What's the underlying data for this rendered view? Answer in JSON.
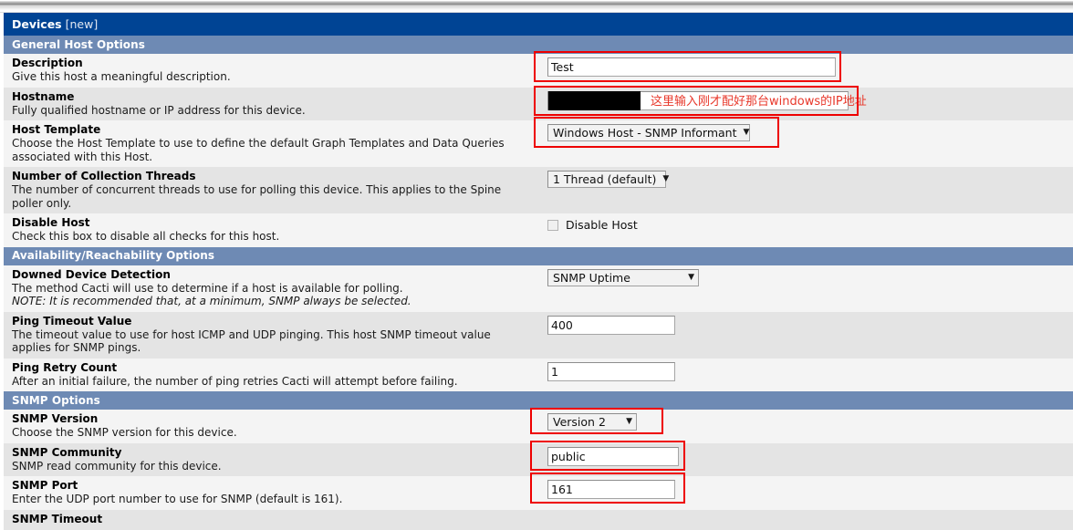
{
  "window": {
    "title_strong": "Devices",
    "title_suffix": "[new]"
  },
  "sections": {
    "general": "General Host Options",
    "availability": "Availability/Reachability Options",
    "snmp": "SNMP Options"
  },
  "fields": {
    "description": {
      "name": "Description",
      "desc": "Give this host a meaningful description.",
      "value": "Test"
    },
    "hostname": {
      "name": "Hostname",
      "desc": "Fully qualified hostname or IP address for this device.",
      "value": "",
      "annotation": "这里输入刚才配好那台windows的IP地址"
    },
    "host_template": {
      "name": "Host Template",
      "desc": "Choose the Host Template to use to define the default Graph Templates and Data Queries associated with this Host.",
      "value": "Windows Host - SNMP Informant"
    },
    "collection_threads": {
      "name": "Number of Collection Threads",
      "desc": "The number of concurrent threads to use for polling this device. This applies to the Spine poller only.",
      "value": "1 Thread (default)"
    },
    "disable_host": {
      "name": "Disable Host",
      "desc": "Check this box to disable all checks for this host.",
      "checkbox_label": "Disable Host",
      "checked": false
    },
    "downed_device_detection": {
      "name": "Downed Device Detection",
      "desc": "The method Cacti will use to determine if a host is available for polling.",
      "note": "NOTE: It is recommended that, at a minimum, SNMP always be selected.",
      "value": "SNMP Uptime"
    },
    "ping_timeout": {
      "name": "Ping Timeout Value",
      "desc": "The timeout value to use for host ICMP and UDP pinging. This host SNMP timeout value applies for SNMP pings.",
      "value": "400"
    },
    "ping_retry": {
      "name": "Ping Retry Count",
      "desc": "After an initial failure, the number of ping retries Cacti will attempt before failing.",
      "value": "1"
    },
    "snmp_version": {
      "name": "SNMP Version",
      "desc": "Choose the SNMP version for this device.",
      "value": "Version 2"
    },
    "snmp_community": {
      "name": "SNMP Community",
      "desc": "SNMP read community for this device.",
      "value": "public"
    },
    "snmp_port": {
      "name": "SNMP Port",
      "desc": "Enter the UDP port number to use for SNMP (default is 161).",
      "value": "161"
    },
    "snmp_timeout": {
      "name": "SNMP Timeout"
    }
  },
  "colors": {
    "title_bar": "#004494",
    "section_bar": "#6e8ab4",
    "annotation_red": "#ee0000",
    "annotation_text_red": "#e8372a",
    "row_light": "#f4f4f4",
    "row_dark": "#e4e4e4"
  },
  "icons": {
    "dropdown_arrow": "▼"
  }
}
